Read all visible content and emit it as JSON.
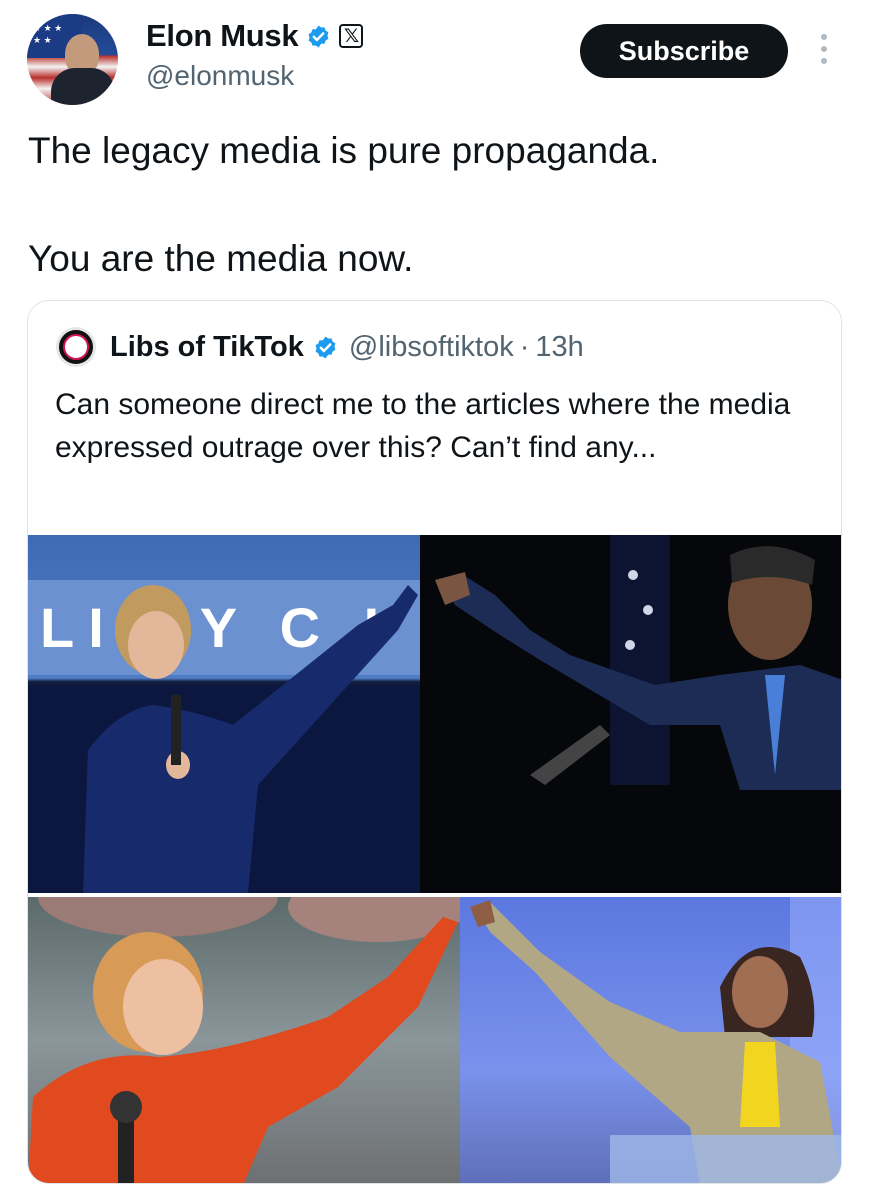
{
  "tweet": {
    "author_name": "Elon Musk",
    "author_handle": "@elonmusk",
    "subscribe_label": "Subscribe",
    "text_line1": "The legacy media is pure propaganda.",
    "text_line2": "You are the media now.",
    "verified_color": "#1d9bf0",
    "icons": [
      "verified-badge-icon",
      "x-logo-icon",
      "more-options-icon"
    ]
  },
  "quoted_tweet": {
    "author_name": "Libs of TikTok",
    "author_handle": "@libsoftiktok",
    "separator": "·",
    "time": "13h",
    "text": "Can someone direct me to the articles where the media expressed outrage over this? Can’t find any...",
    "image_sign_text": "LI  RY C  I"
  }
}
